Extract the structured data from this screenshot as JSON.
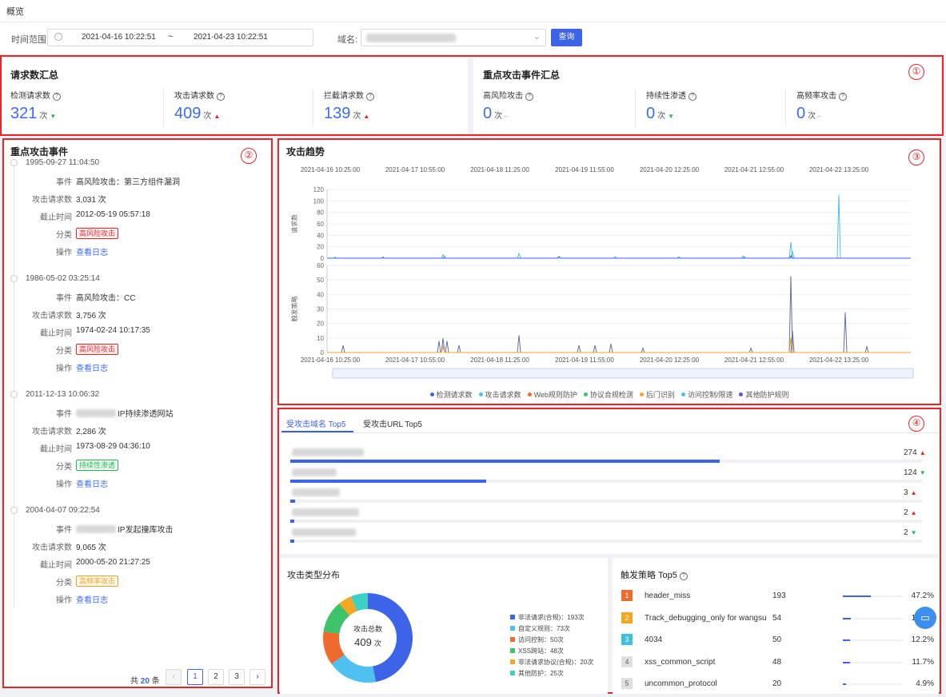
{
  "page": {
    "title": "概览"
  },
  "filter": {
    "time_label": "时间范围:",
    "start": "2021-04-16 10:22:51",
    "sep": "~",
    "end": "2021-04-23 10:22:51",
    "domain_label": "域名:",
    "query_btn": "查询"
  },
  "summary": {
    "title": "请求数汇总",
    "items": [
      {
        "label": "检测请求数",
        "value": "321",
        "unit": "次",
        "trend": "down"
      },
      {
        "label": "攻击请求数",
        "value": "409",
        "unit": "次",
        "trend": "up"
      },
      {
        "label": "拦截请求数",
        "value": "139",
        "unit": "次",
        "trend": "up"
      }
    ]
  },
  "key_summary": {
    "title": "重点攻击事件汇总",
    "items": [
      {
        "label": "高风险攻击",
        "value": "0",
        "unit": "次",
        "trend": "flat"
      },
      {
        "label": "持续性渗透",
        "value": "0",
        "unit": "次",
        "trend": "down"
      },
      {
        "label": "高频率攻击",
        "value": "0",
        "unit": "次",
        "trend": "flat"
      }
    ]
  },
  "markers": [
    "①",
    "②",
    "③",
    "④"
  ],
  "events": {
    "title": "重点攻击事件",
    "keys": {
      "event": "事件",
      "count": "攻击请求数",
      "deadline": "截止时间",
      "category": "分类",
      "action": "操作"
    },
    "items": [
      {
        "time": "1995-09-27 11:04:50",
        "event": "高风险攻击：第三方组件漏洞",
        "count": "3,031 次",
        "deadline": "2012-05-19 05:57:18",
        "category": "高风险攻击",
        "cat_color": "#e8262a",
        "cat_bg": "#fff1f0",
        "action": "查看日志"
      },
      {
        "time": "1986-05-02 03:25:14",
        "event": "高风险攻击：CC",
        "count": "3,756 次",
        "deadline": "1974-02-24 10:17:35",
        "category": "高风险攻击",
        "cat_color": "#e8262a",
        "cat_bg": "#fff1f0",
        "action": "查看日志"
      },
      {
        "time": "2011-12-13 10:06:32",
        "event": "IP持续渗透网站",
        "count": "2,286 次",
        "deadline": "1973-08-29 04:36:10",
        "category": "持续性渗透",
        "cat_color": "#2bb15b",
        "cat_bg": "#f0fff4",
        "action": "查看日志"
      },
      {
        "time": "2004-04-07 09:22:54",
        "event": "IP发起撞库攻击",
        "count": "9,065 次",
        "deadline": "2000-05-20 21:27:25",
        "category": "高频率攻击",
        "cat_color": "#f0a020",
        "cat_bg": "#fffaf0",
        "action": "查看日志"
      }
    ],
    "pagination": {
      "total_prefix": "共",
      "total": "20",
      "total_suffix": "条",
      "pages": [
        "1",
        "2",
        "3"
      ],
      "prev": "‹",
      "next": "›"
    }
  },
  "trend": {
    "title": "攻击趋势",
    "top_ticks": [
      "2021-04-16 10:25:00",
      "2021-04-17 10:55:00",
      "2021-04-18 11:25:00",
      "2021-04-19 11:55:00",
      "2021-04-20 12:25:00",
      "2021-04-21 12:55:00",
      "2021-04-22 13:25:00"
    ],
    "bottom_ticks": [
      "2021-04-16 10:25:00",
      "2021-04-17 10:55:00",
      "2021-04-18 11:25:00",
      "2021-04-19 11:55:00",
      "2021-04-20 12:25:00",
      "2021-04-21 12:55:00",
      "2021-04-22 13:25:00"
    ],
    "top_ylabel": "请求数",
    "bottom_ylabel": "触发策略",
    "top_yticks": [
      "120",
      "100",
      "80",
      "60",
      "40",
      "20",
      "0"
    ],
    "bottom_yticks": [
      "60",
      "50",
      "40",
      "30",
      "20",
      "10",
      "0"
    ],
    "legend": [
      {
        "name": "检测请求数",
        "color": "#3c63e8"
      },
      {
        "name": "攻击请求数",
        "color": "#4ec1e0"
      },
      {
        "name": "Web规则防护",
        "color": "#f06a2e"
      },
      {
        "name": "协议合规检测",
        "color": "#3ec26a"
      },
      {
        "name": "后门识别",
        "color": "#f5a623"
      },
      {
        "name": "访问控制/限速",
        "color": "#4ec1e0"
      },
      {
        "name": "其他防护规则",
        "color": "#6a4ce0"
      }
    ]
  },
  "top5": {
    "tabs": [
      "受攻击域名 Top5",
      "受攻击URL Top5"
    ],
    "rows": [
      {
        "value": "274",
        "trend": "up",
        "pct": 0.68
      },
      {
        "value": "124",
        "trend": "down",
        "pct": 0.31
      },
      {
        "value": "3",
        "trend": "up",
        "pct": 0.008
      },
      {
        "value": "2",
        "trend": "up",
        "pct": 0.006
      },
      {
        "value": "2",
        "trend": "down",
        "pct": 0.006
      }
    ]
  },
  "chart_data": {
    "type": "pie",
    "title": "攻击类型分布",
    "center_label": "攻击总数",
    "center_value": "409",
    "center_unit": "次",
    "slices": [
      {
        "name": "非法请求(合规)：193次",
        "value": 193,
        "color": "#3c63e8"
      },
      {
        "name": "自定义规则：73次",
        "value": 73,
        "color": "#4ec1f0"
      },
      {
        "name": "访问控制：50次",
        "value": 50,
        "color": "#f06a2e"
      },
      {
        "name": "XSS跨站：48次",
        "value": 48,
        "color": "#3ec26a"
      },
      {
        "name": "非法请求协议(合规)：20次",
        "value": 20,
        "color": "#f5a623"
      },
      {
        "name": "其他防护：25次",
        "value": 25,
        "color": "#3ed0c0"
      }
    ]
  },
  "strategy": {
    "title": "触发策略 Top5",
    "rows": [
      {
        "rank": "1",
        "name": "header_miss",
        "count": "193",
        "pct": "47.2%",
        "frac": 0.472,
        "color": "#f06a2e"
      },
      {
        "rank": "2",
        "name": "Track_debugging_only for wangsu",
        "count": "54",
        "pct": "13.2%",
        "frac": 0.132,
        "color": "#f5a623"
      },
      {
        "rank": "3",
        "name": "4034",
        "count": "50",
        "pct": "12.2%",
        "frac": 0.122,
        "color": "#3ec1e0"
      },
      {
        "rank": "4",
        "name": "xss_common_script",
        "count": "48",
        "pct": "11.7%",
        "frac": 0.117,
        "color": "#e0e0e0"
      },
      {
        "rank": "5",
        "name": "uncommon_protocol",
        "count": "20",
        "pct": "4.9%",
        "frac": 0.049,
        "color": "#e0e0e0"
      }
    ]
  }
}
